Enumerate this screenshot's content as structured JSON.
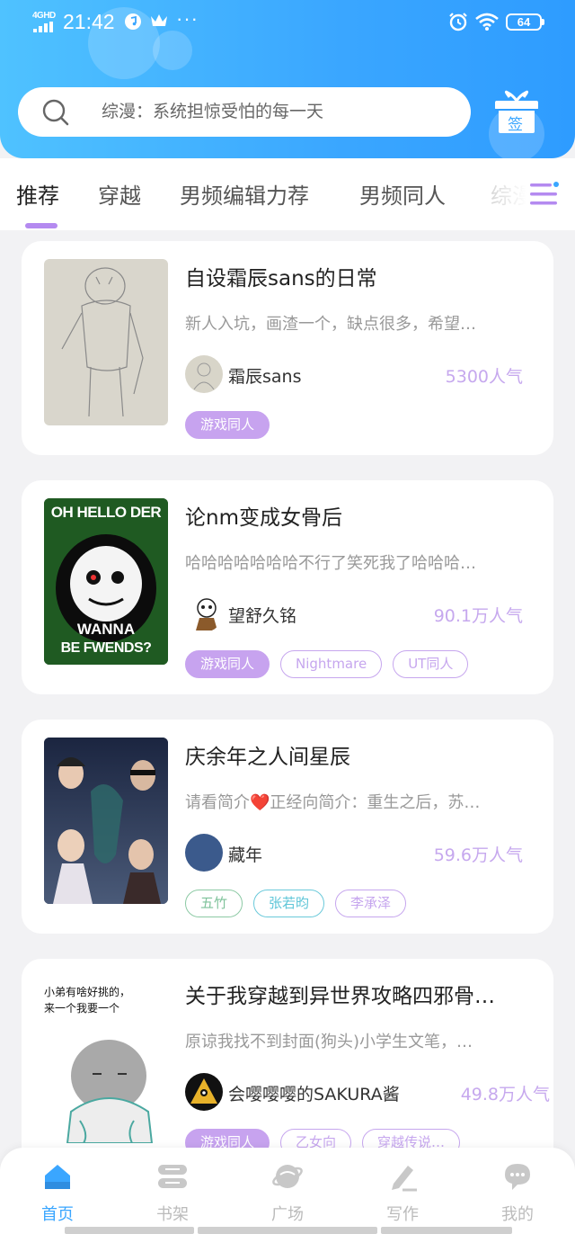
{
  "status_bar": {
    "network": "4GHD",
    "time": "21:42",
    "more": "···",
    "battery": "64"
  },
  "search": {
    "placeholder": "综漫：系统担惊受怕的每一天"
  },
  "gift": {
    "label": "签"
  },
  "tabs": [
    {
      "label": "推荐",
      "active": true
    },
    {
      "label": "穿越"
    },
    {
      "label": "男频编辑力荐"
    },
    {
      "label": "男频同人"
    },
    {
      "label": "综漫"
    }
  ],
  "books": [
    {
      "title": "自设霜辰sans的日常",
      "description": "新人入坑，画渣一个，缺点很多，希望…",
      "author": "霜辰sans",
      "popularity": "5300人气",
      "tags": [
        {
          "label": "游戏同人",
          "style": "filled"
        }
      ]
    },
    {
      "title": "论nm变成女骨后",
      "description": "哈哈哈哈哈哈哈不行了笑死我了哈哈哈…",
      "author": "望舒久铭",
      "popularity": "90.1万人气",
      "cover_text_top": "OH HELLO DER",
      "cover_text_bottom_1": "WANNA",
      "cover_text_bottom_2": "BE FWENDS?",
      "tags": [
        {
          "label": "游戏同人",
          "style": "filled"
        },
        {
          "label": "Nightmare",
          "style": "purple"
        },
        {
          "label": "UT同人",
          "style": "purple"
        }
      ]
    },
    {
      "title": "庆余年之人间星辰",
      "description": "请看简介❤️正经向简介：重生之后，苏…",
      "author": "藏年",
      "popularity": "59.6万人气",
      "tags": [
        {
          "label": "五竹",
          "style": "green"
        },
        {
          "label": "张若昀",
          "style": "cyan"
        },
        {
          "label": "李承泽",
          "style": "purple"
        }
      ]
    },
    {
      "title": "关于我穿越到异世界攻略四邪骨…",
      "description": "原谅我找不到封面(狗头)小学生文笔，…",
      "author": "会嘤嘤嘤的SAKURA酱",
      "popularity": "49.8万人气",
      "cover_text_1": "小弟有啥好挑的，",
      "cover_text_2": "来一个我要一个",
      "tags": [
        {
          "label": "游戏同人",
          "style": "filled"
        },
        {
          "label": "乙女向",
          "style": "purple"
        },
        {
          "label": "穿越传说…",
          "style": "purple"
        }
      ]
    }
  ],
  "bottom_nav": [
    {
      "label": "首页",
      "icon": "home-icon",
      "active": true
    },
    {
      "label": "书架",
      "icon": "bookshelf-icon"
    },
    {
      "label": "广场",
      "icon": "planet-icon"
    },
    {
      "label": "写作",
      "icon": "pen-icon"
    },
    {
      "label": "我的",
      "icon": "chat-bubble-icon"
    }
  ],
  "colors": {
    "header_gradient_start": "#4fc2ff",
    "header_gradient_end": "#2e9cff",
    "accent_purple": "#c7a3ef",
    "active_blue": "#3aa6ff"
  }
}
